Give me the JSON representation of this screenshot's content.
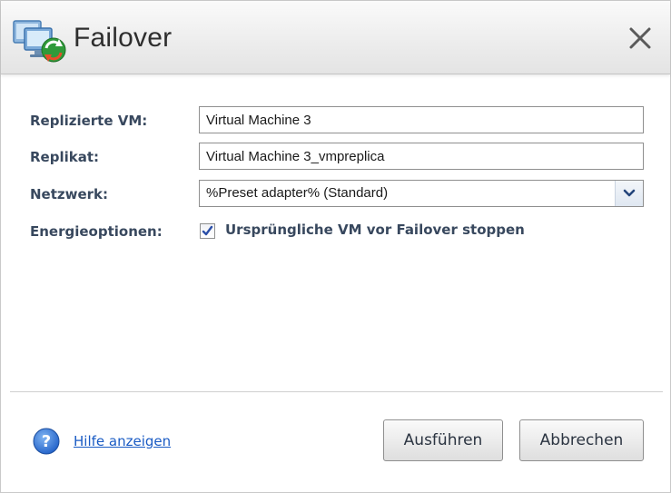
{
  "window": {
    "title": "Failover",
    "close_icon": "close-icon",
    "app_icon": "failover-computers-icon"
  },
  "form": {
    "replicated_vm": {
      "label": "Replizierte VM:",
      "value": "Virtual Machine 3"
    },
    "replica": {
      "label": "Replikat:",
      "value": "Virtual Machine 3_vmpreplica"
    },
    "network": {
      "label": "Netzwerk:",
      "selected": "%Preset adapter% (Standard)"
    },
    "power_options": {
      "label": "Energieoptionen:",
      "checkbox_label": "Ursprüngliche VM vor Failover stoppen",
      "checked": true
    }
  },
  "footer": {
    "help_label": "Hilfe anzeigen",
    "run_label": "Ausführen",
    "cancel_label": "Abbrechen"
  },
  "colors": {
    "label_text": "#38485e",
    "link": "#1a5bc4",
    "checkmark": "#2b4fa8"
  }
}
